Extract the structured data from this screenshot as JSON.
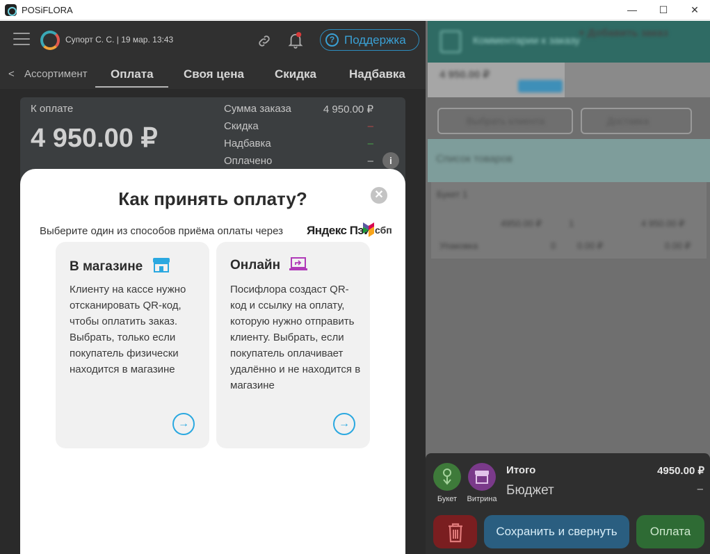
{
  "window": {
    "title": "POSiFLORA",
    "minimize": "—",
    "maximize": "☐",
    "close": "✕"
  },
  "topbar": {
    "user_info": "Супорт С. С. | 19 мар. 13:43",
    "support_icon": "?",
    "support_label": "Поддержка"
  },
  "tabs": {
    "back_icon": "<",
    "back_label": "Ассортимент",
    "items": [
      "Оплата",
      "Своя цена",
      "Скидка",
      "Надбавка"
    ]
  },
  "summary": {
    "to_pay_label": "К оплате",
    "to_pay_value": "4 950.00 ₽",
    "rows": [
      {
        "label": "Сумма заказа",
        "value": "4 950.00 ₽"
      },
      {
        "label": "Скидка",
        "value": "–"
      },
      {
        "label": "Надбавка",
        "value": "–"
      },
      {
        "label": "Оплачено",
        "value": "–"
      }
    ],
    "info_icon": "i"
  },
  "modal": {
    "title": "Как принять оплату?",
    "close_icon": "✕",
    "subtitle": "Выберите один из способов приёма оплаты через",
    "yandex_pay": "Яндекс Пэй",
    "sbp": "сбп",
    "options": [
      {
        "title": "В магазине",
        "description": "Клиенту на кассе нужно отсканировать QR-код, чтобы оплатить заказ. Выбрать, только если покупатель физически находится в магазине"
      },
      {
        "title": "Онлайн",
        "description": "Посифлора создаст QR-код и ссылку на оплату, которую нужно отправить клиенту. Выбрать, если покупатель оплачивает удалённо и не находится в магазине"
      }
    ],
    "arrow_icon": "→"
  },
  "order_panel": {
    "header": "Комментарии к заказу",
    "tab_total": "4 950.00 ₽",
    "tab_add": "+ Добавить заказ",
    "button_left": "Выбрать клиента",
    "button_right": "Доставка",
    "section": "Список товаров",
    "item_name": "Букет 1",
    "item_price": "4950.00 ₽",
    "item_qty": "1",
    "item_total": "4 950.00 ₽",
    "item_row2": "Упаковка",
    "item_row2_qty": "0",
    "item_row2_price": "0.00 ₽",
    "item_row2_total": "0.00 ₽"
  },
  "bottom": {
    "bouquet_label": "Букет",
    "showcase_label": "Витрина",
    "total_label": "Итого",
    "total_value": "4950.00 ₽",
    "budget_label": "Бюджет",
    "budget_value": "–",
    "save_label": "Сохранить и свернуть",
    "pay_label": "Оплата"
  },
  "colors": {
    "accent_blue": "#2aa8e0",
    "pay_green": "#2f8a3a",
    "save_blue": "#2f7fb0",
    "delete_red": "#b1262a"
  }
}
